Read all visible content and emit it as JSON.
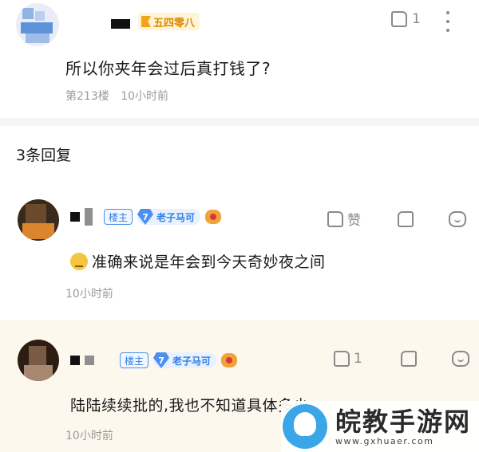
{
  "post": {
    "level_label": "五四零八",
    "like_count": "1",
    "text": "所以你夹年会过后真打钱了?",
    "floor": "第213楼",
    "time": "10小时前"
  },
  "replies_header": "3条回复",
  "replies": [
    {
      "host_tag": "楼主",
      "level_num": "7",
      "level_name": "老子马可",
      "like_label": "赞",
      "text": "准确来说是年会到今天奇妙夜之间",
      "time": "10小时前"
    },
    {
      "host_tag": "楼主",
      "level_num": "7",
      "level_name": "老子马可",
      "like_count": "1",
      "text": "陆陆续续批的,我也不知道具体多少",
      "time": "10小时前"
    }
  ],
  "watermark": {
    "title": "皖教手游网",
    "url": "www.gxhuaer.com"
  },
  "colors": {
    "accent_blue": "#2f7de1",
    "level_gold": "#d98b00",
    "muted": "#9a9a9a",
    "reply_highlight_bg": "#fdf8ee"
  }
}
